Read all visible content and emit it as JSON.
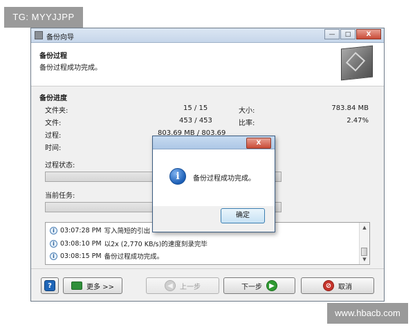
{
  "watermarks": {
    "top_left": "TG: MYYJJPP",
    "bottom_right": "www.hbacb.com"
  },
  "window": {
    "title": "备份向导",
    "controls": {
      "minimize": "—",
      "maximize": "□",
      "close": "X"
    }
  },
  "header": {
    "title": "备份过程",
    "subtitle": "备份过程成功完成。"
  },
  "progress": {
    "section_title": "备份进度",
    "folders_label": "文件夹:",
    "folders_value": "15 / 15",
    "size_label": "大小:",
    "size_value": "783.84 MB",
    "files_label": "文件:",
    "files_value": "453 / 453",
    "ratio_label": "比率:",
    "ratio_value": "2.47%",
    "process_label": "过程:",
    "process_value": "803.69 MB / 803.69",
    "time_label": "时间:",
    "status_label": "过程状态:",
    "task_label": "当前任务:"
  },
  "log": [
    {
      "time": "03:07:28 PM",
      "text": "写入简短的引出"
    },
    {
      "time": "03:08:10 PM",
      "text": "以2x (2,770 KB/s)的速度刻录完毕"
    },
    {
      "time": "03:08:15 PM",
      "text": "备份过程成功完成。"
    }
  ],
  "footer": {
    "help_glyph": "?",
    "more_label": "更多 >>",
    "back_label": "上一步",
    "next_label": "下一步",
    "cancel_label": "取消"
  },
  "dialog": {
    "close_glyph": "X",
    "info_glyph": "i",
    "message": "备份过程成功完成。",
    "ok_label": "确定"
  }
}
